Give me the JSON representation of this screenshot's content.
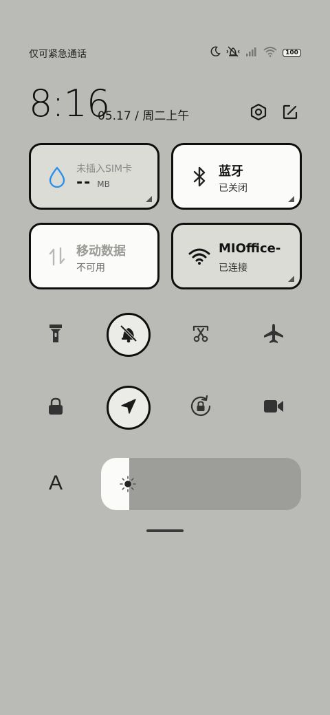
{
  "status_bar": {
    "carrier_text": "仅可紧急通话",
    "battery_level": "100",
    "icons": [
      "moon-icon",
      "vibrate-off-icon",
      "signal-icon",
      "wifi-icon",
      "battery-icon"
    ]
  },
  "header": {
    "time": "8:16",
    "date": "05.17 / 周二上午",
    "settings_icon": "hex-gear-icon",
    "edit_icon": "edit-icon"
  },
  "tiles": [
    {
      "title": "未插入SIM卡",
      "value": "--",
      "unit": "MB",
      "icon": "water-drop-icon",
      "state": "inactive"
    },
    {
      "title": "蓝牙",
      "sub": "已关闭",
      "icon": "bluetooth-icon",
      "state": "off"
    },
    {
      "title": "移动数据",
      "sub": "不可用",
      "icon": "data-arrows-icon",
      "state": "disabled"
    },
    {
      "title": "MIOffice-",
      "sub": "已连接",
      "icon": "wifi-icon",
      "state": "on"
    }
  ],
  "toggles": [
    {
      "name": "flashlight",
      "icon": "flashlight-icon",
      "active": false
    },
    {
      "name": "silent",
      "icon": "bell-off-icon",
      "active": true
    },
    {
      "name": "screenshot",
      "icon": "scissors-icon",
      "active": false
    },
    {
      "name": "airplane",
      "icon": "airplane-icon",
      "active": false
    },
    {
      "name": "lock",
      "icon": "lock-icon",
      "active": false
    },
    {
      "name": "location",
      "icon": "location-arrow-icon",
      "active": true
    },
    {
      "name": "rotation-lock",
      "icon": "rotation-lock-icon",
      "active": false
    },
    {
      "name": "screen-record",
      "icon": "video-camera-icon",
      "active": false
    }
  ],
  "font_label": "A",
  "brightness": {
    "level": 0.14,
    "icon": "sun-icon"
  },
  "colors": {
    "background": "#babbb6",
    "tile_light": "#fbfbf9",
    "tile_gray": "#dcdcd7",
    "accent_drop": "#2a8fe6"
  }
}
